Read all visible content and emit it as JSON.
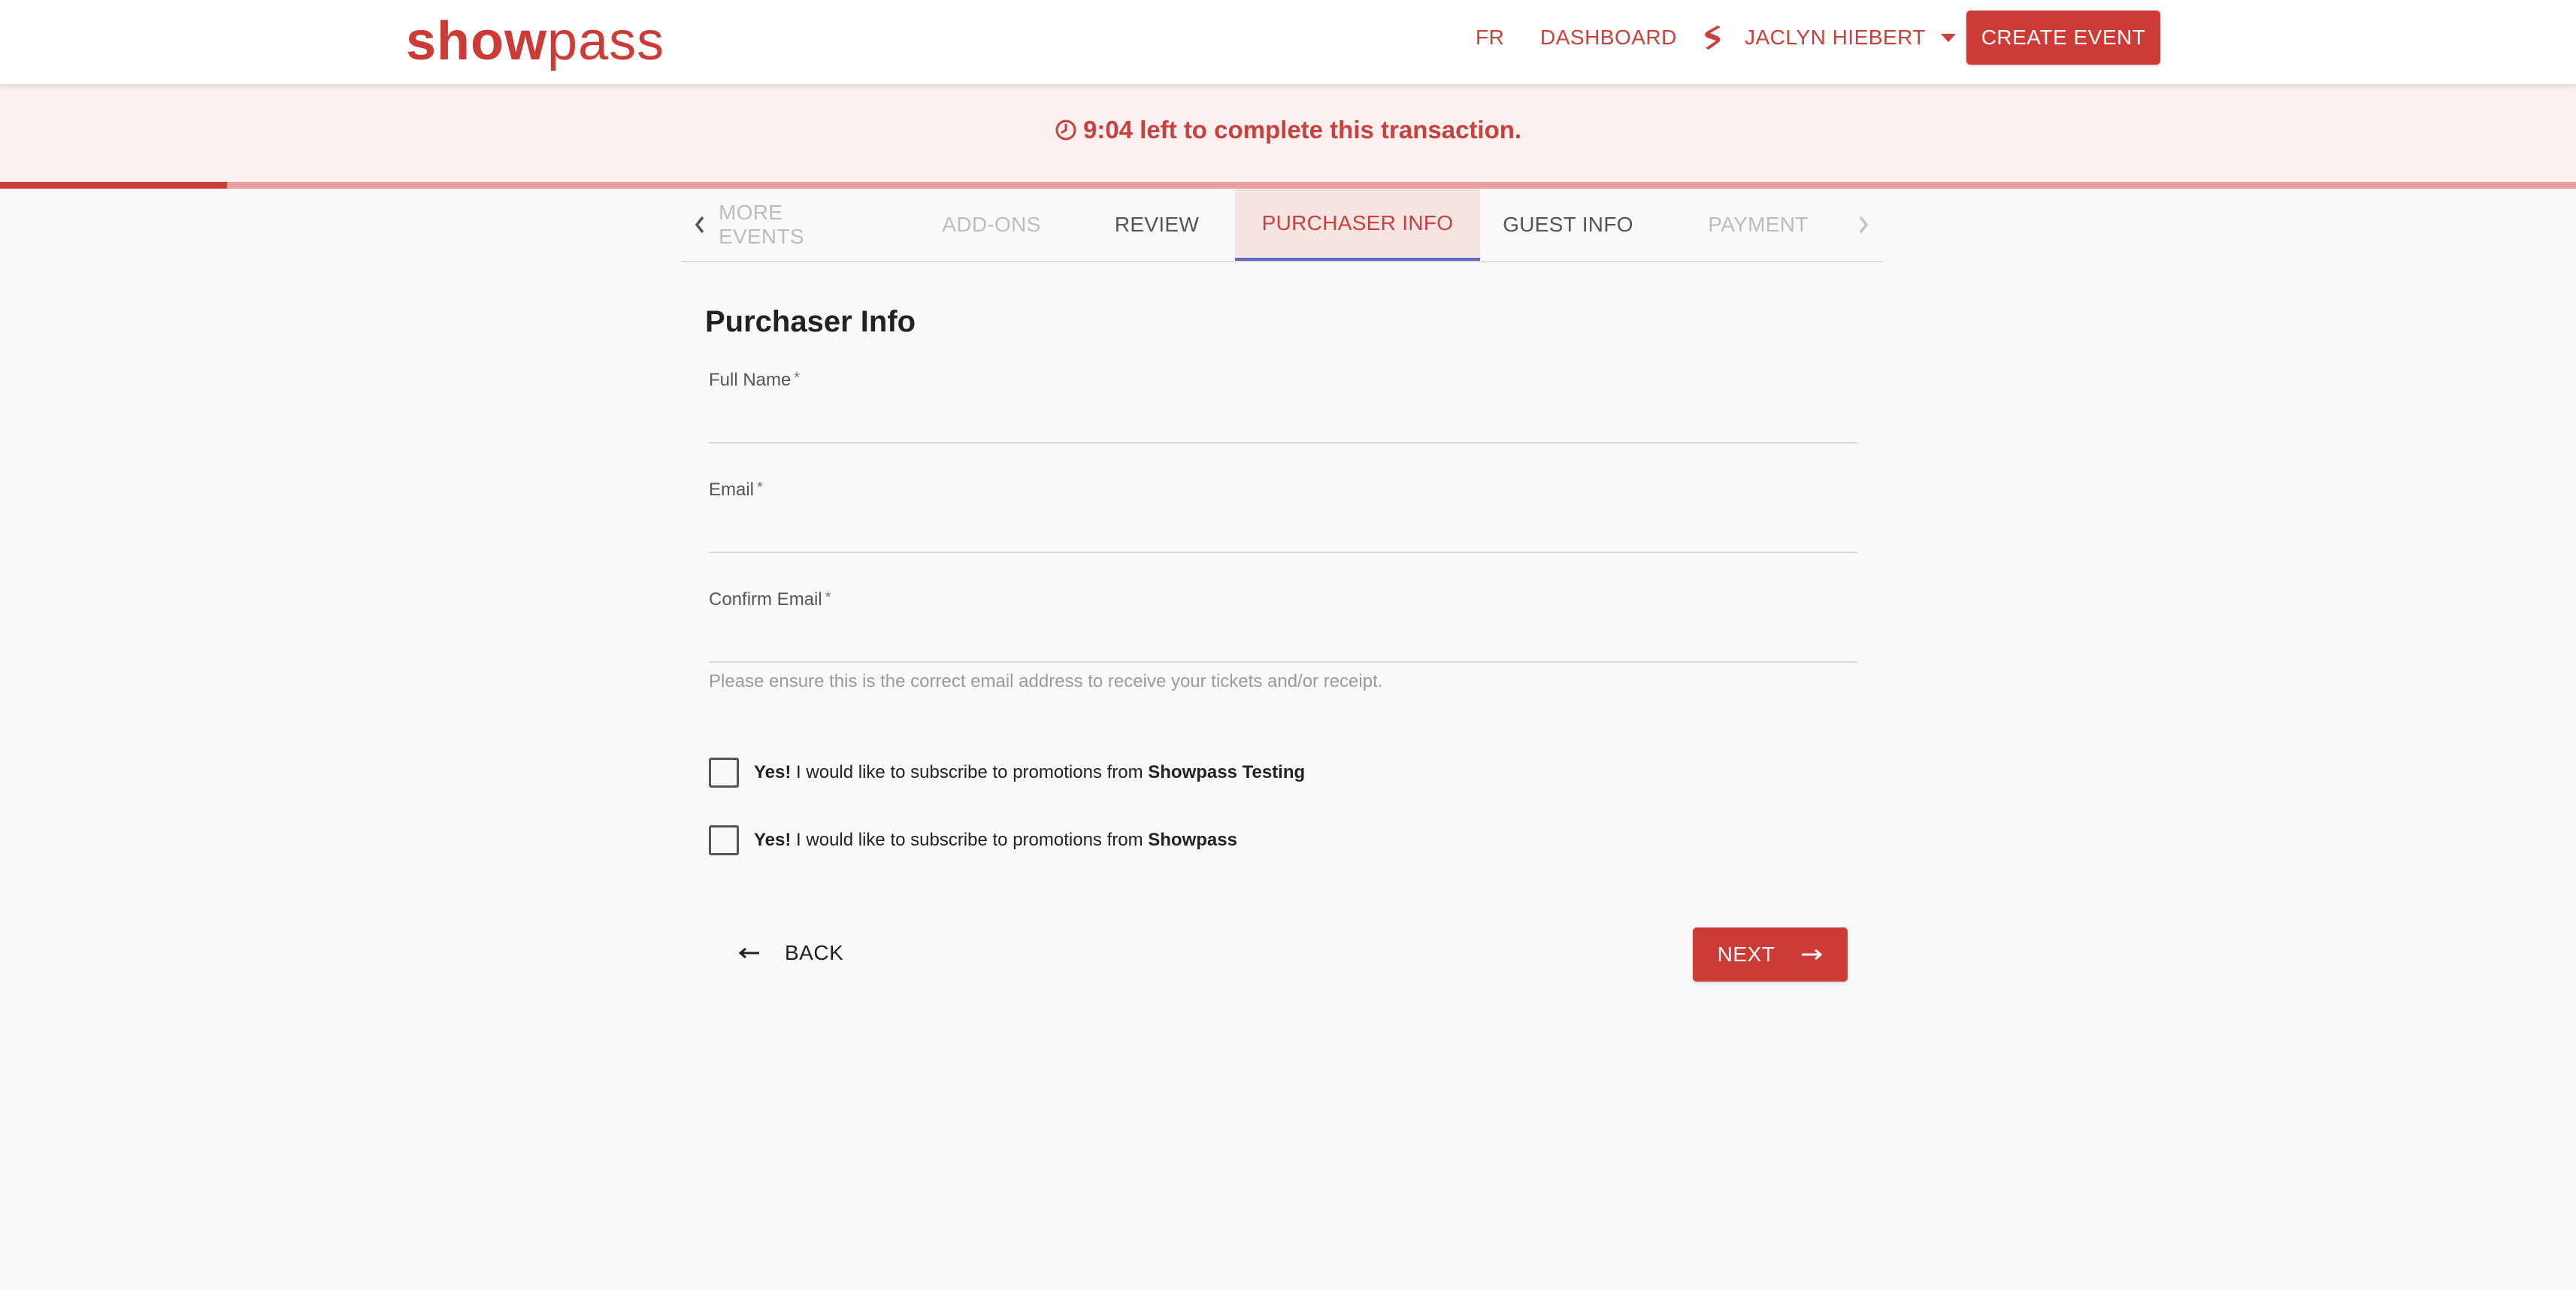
{
  "header": {
    "logo_bold": "show",
    "logo_light": "pass",
    "lang_link": "FR",
    "dashboard_link": "DASHBOARD",
    "user_name": "JACLYN HIEBERT",
    "create_event": "CREATE EVENT"
  },
  "timer": {
    "text": "9:04 left to complete this transaction.",
    "progress_fraction": 0.088
  },
  "tabs": [
    {
      "label": "MORE EVENTS",
      "state": "disabled"
    },
    {
      "label": "ADD-ONS",
      "state": "disabled"
    },
    {
      "label": "REVIEW",
      "state": "normal"
    },
    {
      "label": "PURCHASER INFO",
      "state": "active"
    },
    {
      "label": "GUEST INFO",
      "state": "normal"
    },
    {
      "label": "PAYMENT",
      "state": "disabled"
    }
  ],
  "form": {
    "title": "Purchaser Info",
    "full_name_label": "Full Name",
    "full_name_value": "",
    "email_label": "Email",
    "email_value": "",
    "confirm_email_label": "Confirm Email",
    "confirm_email_value": "",
    "required_mark": "*",
    "hint": "Please ensure this is the correct email address to receive your tickets and/or receipt.",
    "subscribe_yes": "Yes!",
    "subscribe_text": "I would like to subscribe to promotions from",
    "subscribe_1_org": "Showpass Testing",
    "subscribe_1_checked": false,
    "subscribe_2_org": "Showpass",
    "subscribe_2_checked": false
  },
  "actions": {
    "back": "BACK",
    "next": "NEXT"
  },
  "colors": {
    "brand": "#cd3b37",
    "banner_bg": "#fbf0ef",
    "tab_indicator": "#5c6bc0"
  },
  "icons": [
    "showpass-brand-icon",
    "clock-icon",
    "chevron-left-icon",
    "chevron-right-icon",
    "caret-down-icon",
    "arrow-left-icon",
    "arrow-right-icon"
  ]
}
